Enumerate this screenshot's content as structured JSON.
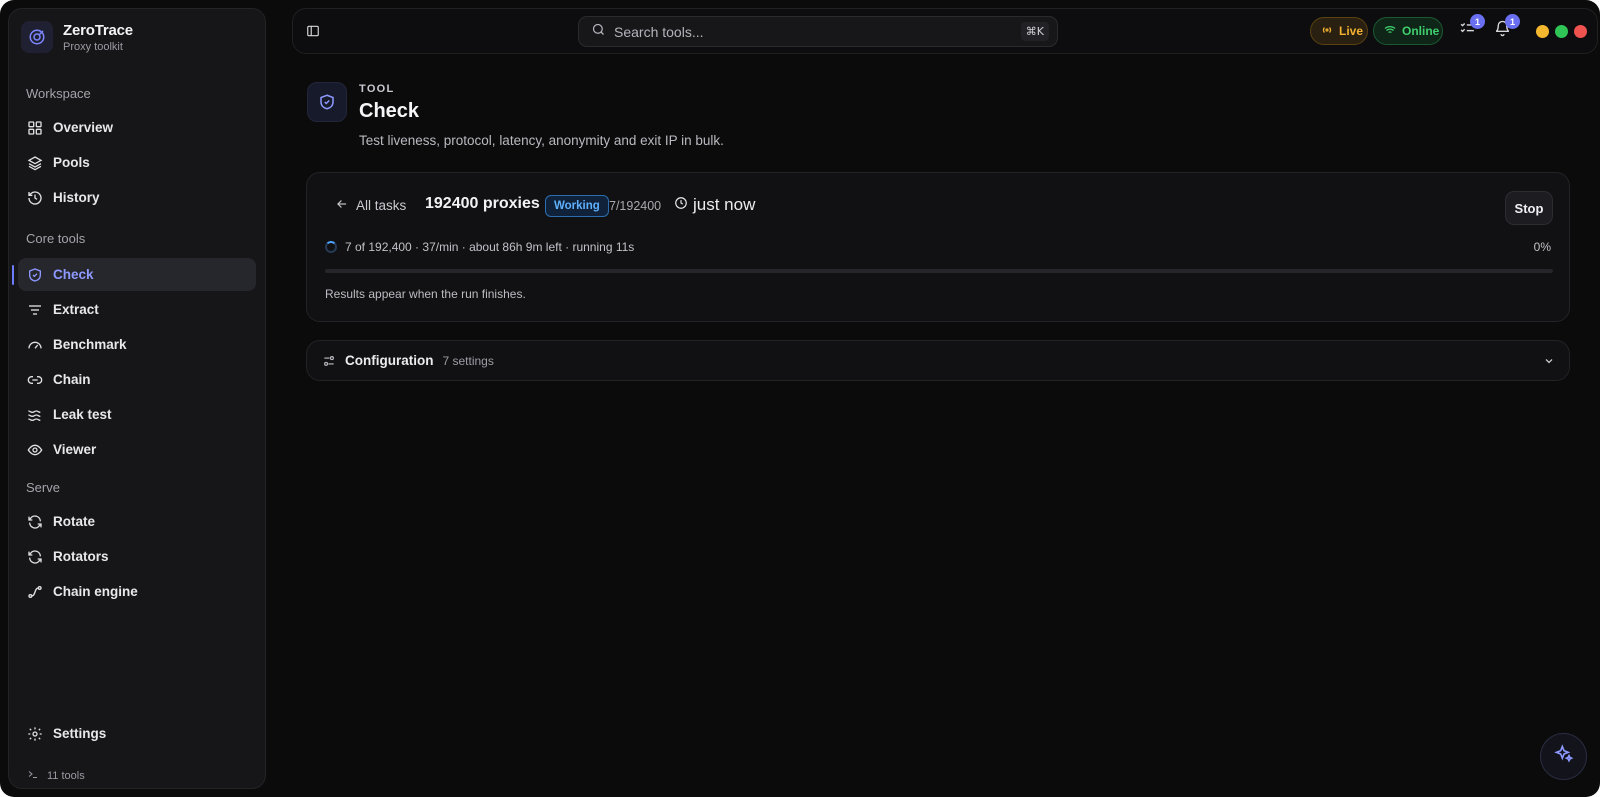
{
  "app": {
    "name": "ZeroTrace",
    "subtitle": "Proxy toolkit"
  },
  "sidebar": {
    "workspace_label": "Workspace",
    "workspace_items": [
      {
        "label": "Overview",
        "icon": "grid-icon"
      },
      {
        "label": "Pools",
        "icon": "layers-icon"
      },
      {
        "label": "History",
        "icon": "history-icon"
      }
    ],
    "core_label": "Core tools",
    "core_items": [
      {
        "label": "Check",
        "icon": "shield-check-icon",
        "active": true
      },
      {
        "label": "Extract",
        "icon": "filter-icon"
      },
      {
        "label": "Benchmark",
        "icon": "gauge-icon"
      },
      {
        "label": "Chain",
        "icon": "link-icon"
      },
      {
        "label": "Leak test",
        "icon": "waves-icon"
      },
      {
        "label": "Viewer",
        "icon": "eye-icon"
      }
    ],
    "serve_label": "Serve",
    "serve_items": [
      {
        "label": "Rotate",
        "icon": "refresh-icon"
      },
      {
        "label": "Rotators",
        "icon": "refresh-icon"
      },
      {
        "label": "Chain engine",
        "icon": "route-icon"
      }
    ],
    "settings_label": "Settings",
    "tools_count": "11 tools"
  },
  "topbar": {
    "search_placeholder": "Search tools...",
    "search_shortcut": "⌘K",
    "live_label": "Live",
    "online_label": "Online",
    "tasks_badge": "1",
    "notifications_badge": "1",
    "colors": {
      "live": "#f2b131",
      "online": "#3fcf6e",
      "dot_yellow": "#f5b72d",
      "dot_green": "#2fc657",
      "dot_red": "#ef5350"
    }
  },
  "page": {
    "kicker": "TOOL",
    "title": "Check",
    "description": "Test liveness, protocol, latency, anonymity and exit IP in bulk."
  },
  "task": {
    "back_label": "All tasks",
    "title": "192400 proxies",
    "status": "Working",
    "count": "7/192400",
    "time": "just now",
    "stop_label": "Stop",
    "progress_text": "7 of 192,400 · 37/min · about 86h 9m left · running 11s",
    "progress_percent_label": "0%",
    "progress_fraction": 3.64e-05,
    "results_note": "Results appear when the run finishes."
  },
  "config": {
    "title": "Configuration",
    "count": "7 settings"
  }
}
